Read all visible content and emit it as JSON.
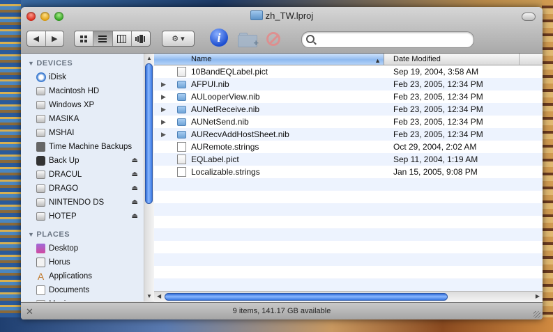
{
  "window": {
    "title": "zh_TW.lproj"
  },
  "toolbar": {
    "back_glyph": "◀",
    "forward_glyph": "▶",
    "view_icons": [
      "icon-view-icon",
      "list-view-icon",
      "column-view-icon",
      "coverflow-view-icon"
    ],
    "action_glyph": "⚙ ▾",
    "info_glyph": "i",
    "search": {
      "value": "",
      "placeholder": ""
    }
  },
  "sidebar": {
    "devices_header": "DEVICES",
    "devices": [
      {
        "label": "iDisk",
        "icon": "idisk-icon",
        "eject": false
      },
      {
        "label": "Macintosh HD",
        "icon": "hard-drive-icon",
        "eject": false
      },
      {
        "label": "Windows XP",
        "icon": "hard-drive-icon",
        "eject": false
      },
      {
        "label": "MASIKA",
        "icon": "hard-drive-icon",
        "eject": false
      },
      {
        "label": "MSHAI",
        "icon": "hard-drive-icon",
        "eject": false
      },
      {
        "label": "Time Machine Backups",
        "icon": "time-machine-icon",
        "eject": false
      },
      {
        "label": "Back Up",
        "icon": "external-drive-icon",
        "eject": true
      },
      {
        "label": "DRACUL",
        "icon": "hard-drive-icon",
        "eject": true
      },
      {
        "label": "DRAGO",
        "icon": "hard-drive-icon",
        "eject": true
      },
      {
        "label": "NINTENDO DS",
        "icon": "hard-drive-icon",
        "eject": true
      },
      {
        "label": "HOTEP",
        "icon": "hard-drive-icon",
        "eject": true
      }
    ],
    "places_header": "PLACES",
    "places": [
      {
        "label": "Desktop",
        "icon": "desktop-icon"
      },
      {
        "label": "Horus",
        "icon": "home-icon"
      },
      {
        "label": "Applications",
        "icon": "applications-icon"
      },
      {
        "label": "Documents",
        "icon": "documents-icon"
      },
      {
        "label": "Movies",
        "icon": "movies-icon"
      }
    ]
  },
  "columns": {
    "name": "Name",
    "date": "Date Modified"
  },
  "files": [
    {
      "name": "10BandEQLabel.pict",
      "date": "Sep 19, 2004, 3:58 AM",
      "kind": "pict",
      "expandable": false
    },
    {
      "name": "AFPUI.nib",
      "date": "Feb 23, 2005, 12:34 PM",
      "kind": "folder",
      "expandable": true
    },
    {
      "name": "AULooperView.nib",
      "date": "Feb 23, 2005, 12:34 PM",
      "kind": "folder",
      "expandable": true
    },
    {
      "name": "AUNetReceive.nib",
      "date": "Feb 23, 2005, 12:34 PM",
      "kind": "folder",
      "expandable": true
    },
    {
      "name": "AUNetSend.nib",
      "date": "Feb 23, 2005, 12:34 PM",
      "kind": "folder",
      "expandable": true
    },
    {
      "name": "AURecvAddHostSheet.nib",
      "date": "Feb 23, 2005, 12:34 PM",
      "kind": "folder",
      "expandable": true
    },
    {
      "name": "AURemote.strings",
      "date": "Oct 29, 2004, 2:02 AM",
      "kind": "file",
      "expandable": false
    },
    {
      "name": "EQLabel.pict",
      "date": "Sep 11, 2004, 1:19 AM",
      "kind": "pict",
      "expandable": false
    },
    {
      "name": "Localizable.strings",
      "date": "Jan 15, 2005, 9:08 PM",
      "kind": "file",
      "expandable": false
    }
  ],
  "empty_rows": 9,
  "status": {
    "text": "9 items, 141.17 GB available"
  }
}
